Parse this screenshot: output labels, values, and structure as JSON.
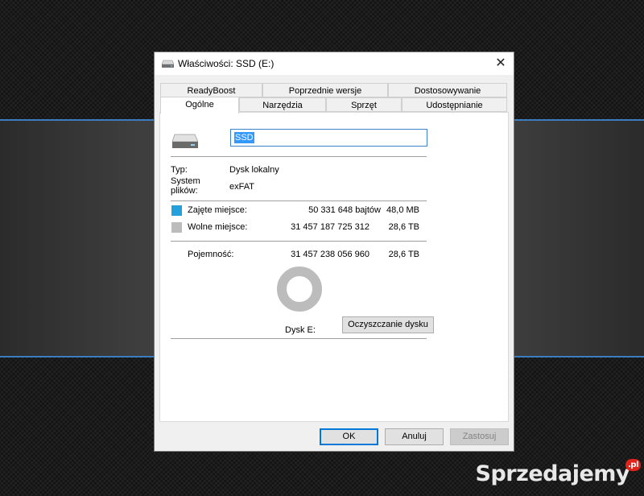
{
  "window": {
    "title": "Właściwości: SSD (E:)",
    "close_glyph": "✕"
  },
  "tabs_back": [
    {
      "label": "ReadyBoost"
    },
    {
      "label": "Poprzednie wersje"
    },
    {
      "label": "Dostosowywanie"
    }
  ],
  "tabs_front": [
    {
      "label": "Ogólne",
      "active": true
    },
    {
      "label": "Narzędzia"
    },
    {
      "label": "Sprzęt"
    },
    {
      "label": "Udostępnianie"
    }
  ],
  "general": {
    "drive_name": "SSD",
    "type_label": "Typ:",
    "type_value": "Dysk lokalny",
    "fs_label_1": "System",
    "fs_label_2": "plików:",
    "fs_value": "exFAT",
    "used_label": "Zajęte miejsce:",
    "used_bytes": "50 331 648 bajtów",
    "used_size": "48,0 MB",
    "used_color": "#26a0da",
    "free_label": "Wolne miejsce:",
    "free_bytes": "31 457 187 725 312",
    "free_size": "28,6 TB",
    "free_color": "#bcbcbc",
    "capacity_label": "Pojemność:",
    "capacity_bytes": "31 457 238 056 960",
    "capacity_size": "28,6 TB",
    "disk_label": "Dysk E:",
    "cleanup_button": "Oczyszczanie dysku",
    "used_fraction": 1.6e-06
  },
  "buttons": {
    "ok": "OK",
    "cancel": "Anuluj",
    "apply": "Zastosuj"
  },
  "watermark": {
    "text": "Sprzedajemy",
    "suffix": ".pl"
  }
}
